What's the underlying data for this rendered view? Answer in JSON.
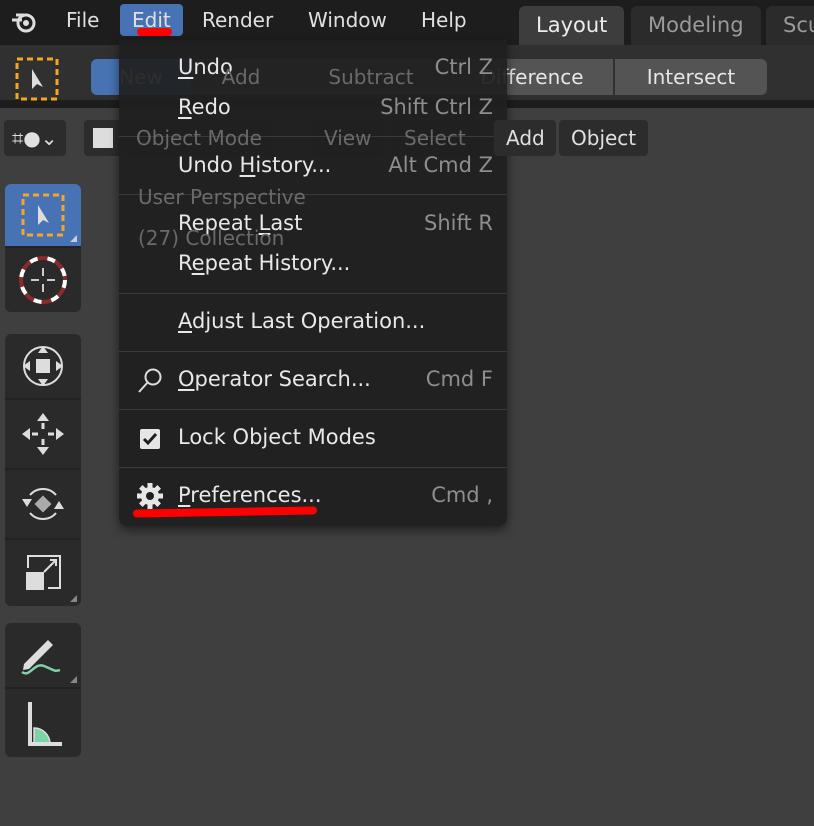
{
  "menubar": {
    "items": [
      "File",
      "Edit",
      "Render",
      "Window",
      "Help"
    ],
    "active": "Edit"
  },
  "workspace_tabs": [
    "Layout",
    "Modeling",
    "Scu"
  ],
  "tool_header": {
    "modes": [
      "New",
      "Add",
      "Subtract",
      "Difference",
      "Intersect"
    ]
  },
  "viewport_header": {
    "mode": "Object Mode",
    "items": [
      "View",
      "Select",
      "Add",
      "Object"
    ]
  },
  "viewport_overlay": {
    "perspective": "User Perspective",
    "collection": "(27) Collection"
  },
  "edit_menu": {
    "undo": {
      "pre": "",
      "key": "U",
      "post": "ndo",
      "shortcut": "Ctrl Z"
    },
    "redo": {
      "pre": "",
      "key": "R",
      "post": "edo",
      "shortcut": "Shift Ctrl Z"
    },
    "undo_history": {
      "pre": "Undo ",
      "key": "H",
      "post": "istory...",
      "shortcut": "Alt Cmd Z"
    },
    "repeat_last": {
      "pre": "Repeat ",
      "key": "L",
      "post": "ast",
      "shortcut": "Shift R"
    },
    "repeat_history": {
      "pre": "R",
      "key": "e",
      "post": "peat History...",
      "shortcut": ""
    },
    "adjust_last": {
      "pre": "",
      "key": "A",
      "post": "djust Last Operation...",
      "shortcut": ""
    },
    "operator_search": {
      "pre": "",
      "key": "O",
      "post": "perator Search...",
      "shortcut": "Cmd F"
    },
    "lock_object_modes": {
      "pre": "Lock Object Modes",
      "key": "",
      "post": "",
      "shortcut": "",
      "checked": true
    },
    "preferences": {
      "pre": "",
      "key": "P",
      "post": "references...",
      "shortcut": "Cmd ,"
    }
  },
  "colors": {
    "accent": "#4772b3",
    "annotation": "#ff0000",
    "menu_bg": "#1f1f1f"
  }
}
